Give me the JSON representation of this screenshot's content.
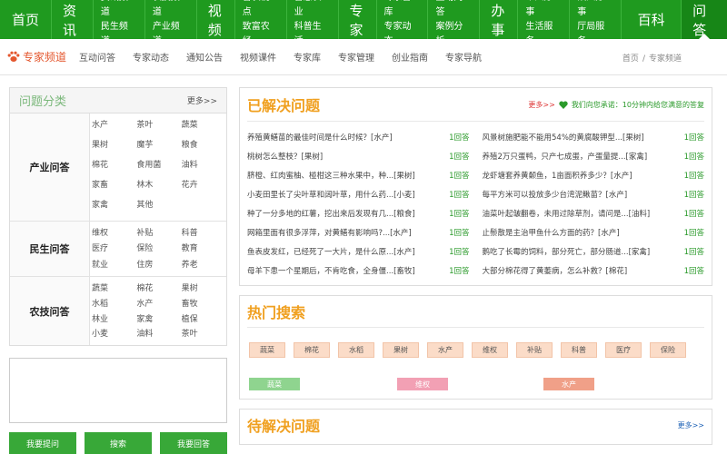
{
  "topnav": {
    "home": "首页",
    "news": "资讯",
    "news_sub": [
      "资讯频道",
      "民生频道"
    ],
    "agri_sub": [
      "农技频道",
      "产业频道"
    ],
    "video": "视频",
    "video_sub": [
      "智农视点",
      "致富农经"
    ],
    "smart_sub": [
      "智慧农业",
      "科普生活"
    ],
    "expert": "专家",
    "expert_sub": [
      "专家智库",
      "专家动态"
    ],
    "interact_sub": [
      "互动问答",
      "案例分析"
    ],
    "affairs": "办事",
    "personal_sub": [
      "个人办事",
      "生活服务"
    ],
    "legal_sub": [
      "法人办事",
      "厅局服务"
    ],
    "baike": "百科",
    "qa": "问答"
  },
  "subnav": {
    "brand": "专家频道",
    "links": [
      "互动问答",
      "专家动态",
      "通知公告",
      "视频课件",
      "专家库",
      "专家管理",
      "创业指南",
      "专家导航"
    ],
    "crumb_home": "首页",
    "crumb_sep": "/",
    "crumb_current": "专家频道"
  },
  "categories": {
    "title": "问题分类",
    "more": "更多>>",
    "groups": [
      {
        "name": "产业问答",
        "items": [
          "水产",
          "茶叶",
          "蔬菜",
          "果树",
          "魔芋",
          "粮食",
          "棉花",
          "食用菌",
          "油料",
          "家畜",
          "林木",
          "花卉",
          "家禽",
          "其他"
        ]
      },
      {
        "name": "民生问答",
        "items": [
          "维权",
          "补贴",
          "科普",
          "医疗",
          "保险",
          "教育",
          "就业",
          "住房",
          "养老"
        ]
      },
      {
        "name": "农技问答",
        "items": [
          "蔬菜",
          "棉花",
          "果树",
          "水稻",
          "水产",
          "畜牧",
          "林业",
          "家禽",
          "植保",
          "小麦",
          "油料",
          "茶叶"
        ]
      }
    ]
  },
  "left_buttons": {
    "ask": "我要提问",
    "search": "搜索",
    "answer": "我要回答"
  },
  "solved": {
    "title": "已解决问题",
    "more": "更多>>",
    "promise": "我们向您承诺：10分钟内给您满意的答复",
    "questions": [
      {
        "q": "养殖黄鳝苗的最佳时间是什么时候？[水产]",
        "n": "1回答"
      },
      {
        "q": "风景树施肥能不能用54%的黄腐酸钾型...[果树]",
        "n": "1回答"
      },
      {
        "q": "桃树怎么整枝？[果树]",
        "n": "1回答"
      },
      {
        "q": "养殖2万只蛋鸭，只产七成蛋，产蛋量提...[家禽]",
        "n": "1回答"
      },
      {
        "q": "脐橙、红肉蜜柚、椪柑这三种水果中，种...[果树]",
        "n": "1回答"
      },
      {
        "q": "龙虾塘套养黄颡鱼，1亩面积养多少？[水产]",
        "n": "1回答"
      },
      {
        "q": "小麦田里长了尖叶草和阔叶草，用什么药...[小麦]",
        "n": "1回答"
      },
      {
        "q": "每平方米可以投放多少台湾泥鳅苗？[水产]",
        "n": "1回答"
      },
      {
        "q": "种了一分多地的红薯，挖出来后发现有几...[粮食]",
        "n": "1回答"
      },
      {
        "q": "油菜叶起皱翻卷，未用过除草剂，请问是...[油料]",
        "n": "1回答"
      },
      {
        "q": "网箱里面有很多浮萍，对黄鳝有影响吗?...[水产]",
        "n": "1回答"
      },
      {
        "q": "止鬃散是主治甲鱼什么方面的药？[水产]",
        "n": "1回答"
      },
      {
        "q": "鱼表皮发红，已经死了一大片，是什么原...[水产]",
        "n": "1回答"
      },
      {
        "q": "鹅吃了长霉的饲料，部分死亡，部分肠道...[家禽]",
        "n": "1回答"
      },
      {
        "q": "母羊下患一个星期后，不肯吃食，全身僵...[畜牧]",
        "n": "1回答"
      },
      {
        "q": "大部分棉花得了黄萎病，怎么补救？[棉花]",
        "n": "1回答"
      }
    ]
  },
  "hot": {
    "title": "热门搜索",
    "tags": [
      "蔬菜",
      "棉花",
      "水稻",
      "果树",
      "水产",
      "维权",
      "补贴",
      "科普",
      "医疗",
      "保险"
    ],
    "big_tags": [
      {
        "label": "蔬菜",
        "color": "#8fd48f"
      },
      {
        "label": "维权",
        "color": "#f2a0b4"
      },
      {
        "label": "水产",
        "color": "#f0a088"
      }
    ]
  },
  "pending": {
    "title": "待解决问题",
    "more": "更多>>"
  },
  "colors": {
    "nav_green": "#1f9a1f",
    "accent_orange": "#f0a020",
    "answer_green": "#2a9a2a"
  }
}
